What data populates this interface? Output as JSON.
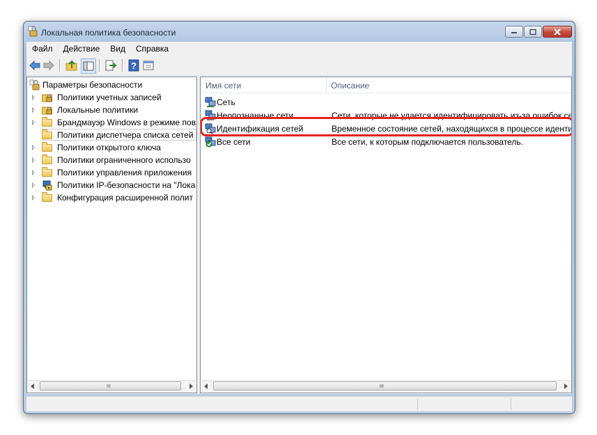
{
  "window": {
    "title": "Локальная политика безопасности"
  },
  "menu": {
    "items": [
      "Файл",
      "Действие",
      "Вид",
      "Справка"
    ]
  },
  "toolbar": {
    "buttons": [
      "back-icon",
      "forward-icon",
      "up-folder-icon",
      "show-hide-tree-icon",
      "export-list-icon",
      "help-icon",
      "properties-icon"
    ]
  },
  "tree": {
    "root": "Параметры безопасности",
    "items": [
      {
        "label": "Политики учетных записей",
        "icon": "locked-folder-icon",
        "expandable": true
      },
      {
        "label": "Локальные политики",
        "icon": "locked-folder-icon",
        "expandable": true
      },
      {
        "label": "Брандмауэр Windows в режиме пов",
        "icon": "folder-icon",
        "expandable": true
      },
      {
        "label": "Политики диспетчера списка сетей",
        "icon": "folder-icon",
        "expandable": false,
        "selected": true
      },
      {
        "label": "Политики открытого ключа",
        "icon": "folder-icon",
        "expandable": true
      },
      {
        "label": "Политики ограниченного использо",
        "icon": "folder-icon",
        "expandable": true
      },
      {
        "label": "Политики управления приложения",
        "icon": "folder-icon",
        "expandable": true
      },
      {
        "label": "Политики IP-безопасности на \"Лока",
        "icon": "ip-security-icon",
        "expandable": true
      },
      {
        "label": "Конфигурация расширенной полит",
        "icon": "folder-icon",
        "expandable": true
      }
    ]
  },
  "list": {
    "columns": [
      "Имя сети",
      "Описание"
    ],
    "rows": [
      {
        "name": "Сеть",
        "description": "",
        "icon": "network-icon"
      },
      {
        "name": "Неопознанные сети",
        "description": "Сети, которые не удается идентифицировать из-за ошибок сет",
        "icon": "network-icon"
      },
      {
        "name": "Идентификация сетей",
        "description": "Временное состояние сетей, находящихся в процессе идентиф",
        "icon": "network-identify-icon",
        "highlighted": true
      },
      {
        "name": "Все сети",
        "description": "Все сети, к которым подключается пользователь.",
        "icon": "all-networks-icon"
      }
    ]
  },
  "scroll": {
    "grip": "III"
  },
  "colors": {
    "highlight_border": "#e8201c",
    "title_bar": "#b9cde6"
  }
}
